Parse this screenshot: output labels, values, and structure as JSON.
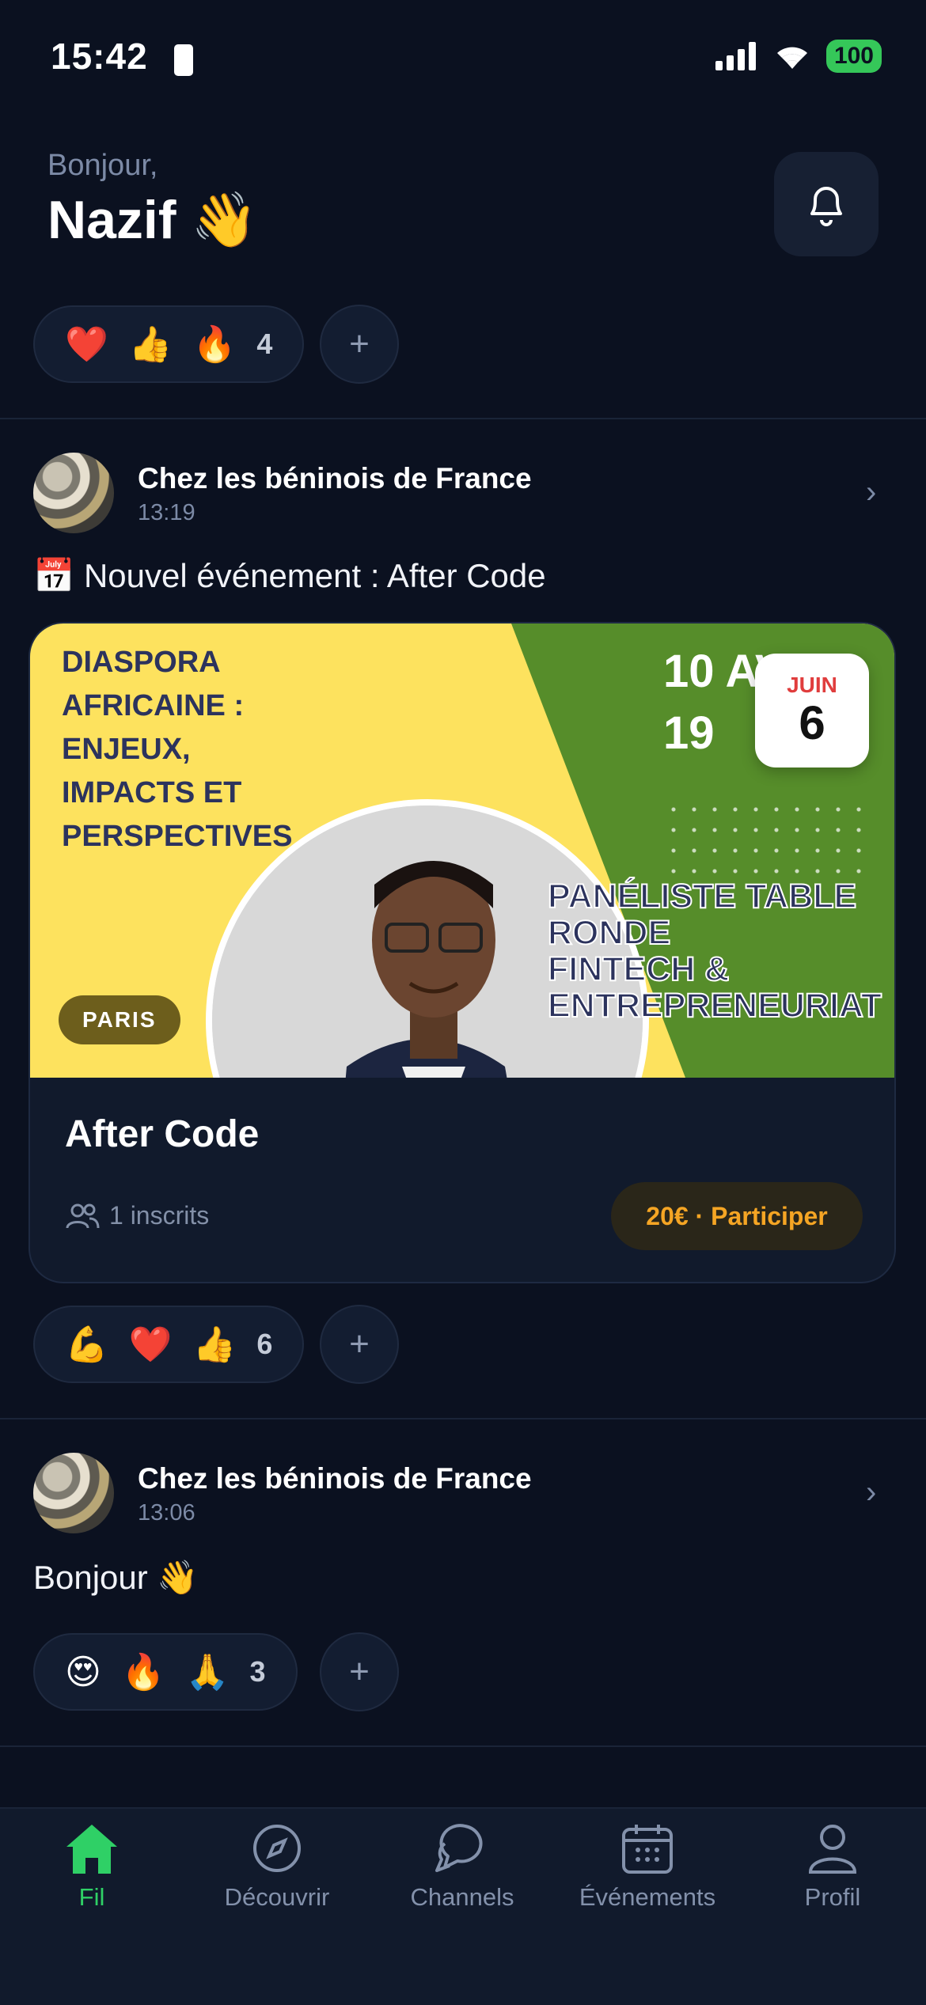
{
  "status_bar": {
    "time": "15:42",
    "battery": "100"
  },
  "header": {
    "greeting": "Bonjour,",
    "name": "Nazif 👋"
  },
  "top_reactions": {
    "emojis": [
      "❤️",
      "👍",
      "🔥"
    ],
    "count": "4",
    "add": "+"
  },
  "posts": [
    {
      "author": "Chez les béninois de France",
      "time": "13:19",
      "text": "📅 Nouvel événement : After Code",
      "event": {
        "banner_title": "DIASPORA\nAFRICAINE :\nENJEUX,\nIMPACTS ET\nPERSPECTIVES",
        "banner_date": "10 AVRIL\n19",
        "banner_panel": "PANÉLISTE TABLE\nRONDE\nFINTECH &\nENTREPRENEURIAT",
        "location_tag": "PARIS",
        "badge_month": "JUIN",
        "badge_day": "6",
        "title": "After Code",
        "registered": "1 inscrits",
        "cta": "20€ · Participer"
      },
      "reactions": {
        "emojis": [
          "💪",
          "❤️",
          "👍"
        ],
        "count": "6",
        "add": "+"
      }
    },
    {
      "author": "Chez les béninois de France",
      "time": "13:06",
      "text": "Bonjour 👋",
      "reactions": {
        "emojis": [
          "😍",
          "🔥",
          "🙏"
        ],
        "count": "3",
        "add": "+"
      }
    }
  ],
  "tabs": [
    {
      "label": "Fil",
      "icon": "home-icon",
      "active": true
    },
    {
      "label": "Découvrir",
      "icon": "compass-icon"
    },
    {
      "label": "Channels",
      "icon": "chat-icon"
    },
    {
      "label": "Événements",
      "icon": "calendar-icon"
    },
    {
      "label": "Profil",
      "icon": "user-icon"
    }
  ],
  "colors": {
    "background": "#0b1120",
    "accent_green": "#2fd066",
    "cta_orange": "#f5a524"
  }
}
